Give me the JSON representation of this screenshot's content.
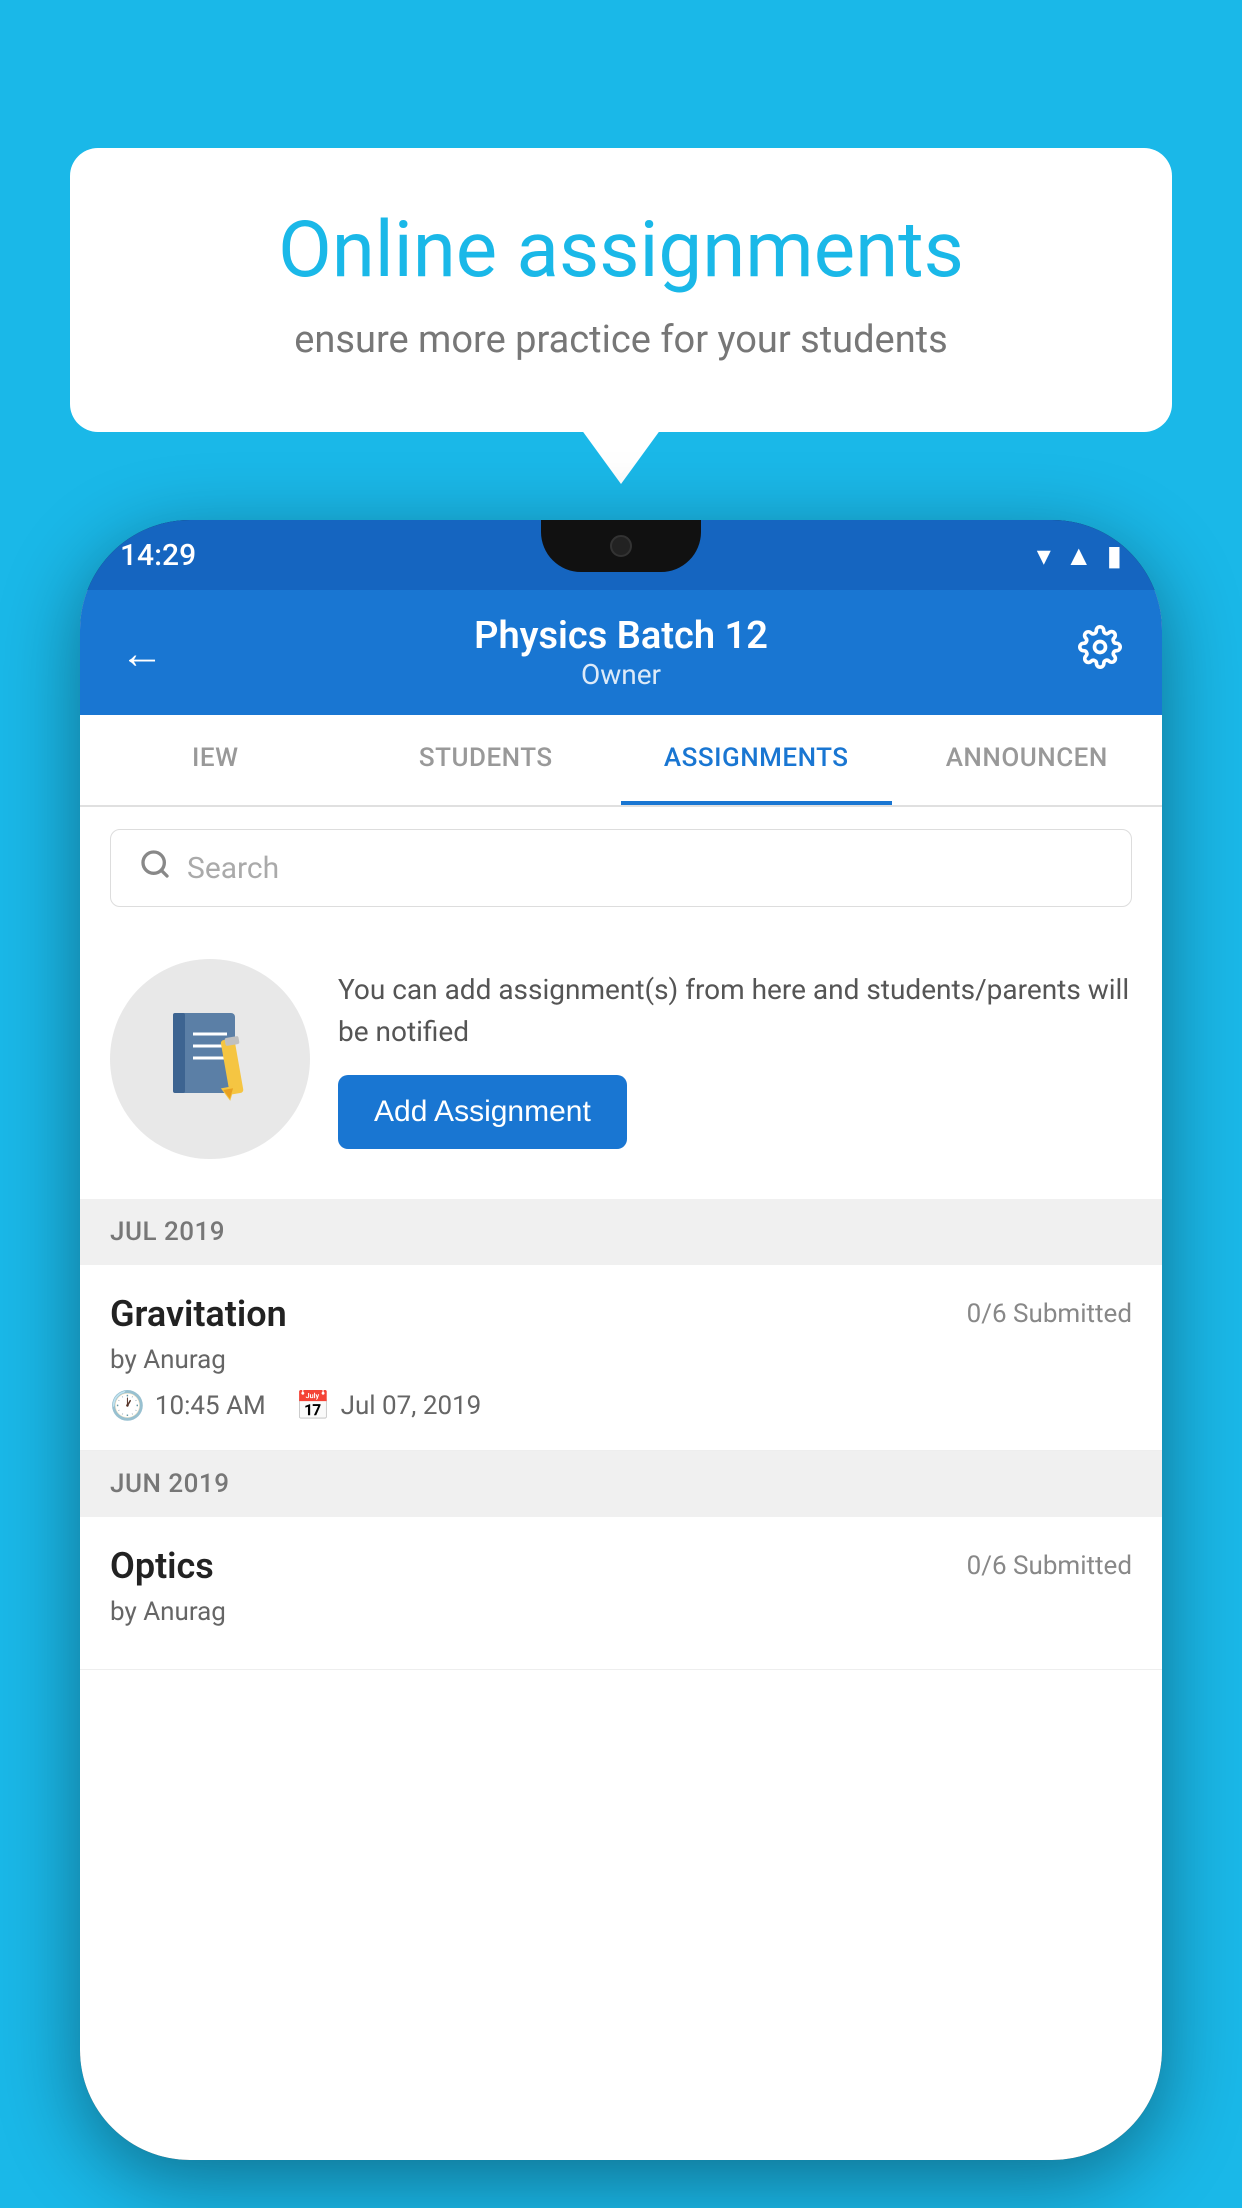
{
  "background_color": "#1ab8e8",
  "speech_bubble": {
    "title": "Online assignments",
    "subtitle": "ensure more practice for your students"
  },
  "phone": {
    "status_bar": {
      "time": "14:29",
      "icons": [
        "wifi",
        "signal",
        "battery"
      ]
    },
    "header": {
      "title": "Physics Batch 12",
      "subtitle": "Owner",
      "back_label": "←",
      "settings_label": "⚙"
    },
    "tabs": [
      {
        "label": "IEW",
        "active": false
      },
      {
        "label": "STUDENTS",
        "active": false
      },
      {
        "label": "ASSIGNMENTS",
        "active": true
      },
      {
        "label": "ANNOUNCEN",
        "active": false
      }
    ],
    "search": {
      "placeholder": "Search"
    },
    "promo": {
      "text": "You can add assignment(s) from here and students/parents will be notified",
      "button_label": "Add Assignment"
    },
    "sections": [
      {
        "header": "JUL 2019",
        "assignments": [
          {
            "name": "Gravitation",
            "status": "0/6 Submitted",
            "by": "by Anurag",
            "time": "10:45 AM",
            "date": "Jul 07, 2019"
          }
        ]
      },
      {
        "header": "JUN 2019",
        "assignments": [
          {
            "name": "Optics",
            "status": "0/6 Submitted",
            "by": "by Anurag",
            "time": "",
            "date": ""
          }
        ]
      }
    ]
  }
}
